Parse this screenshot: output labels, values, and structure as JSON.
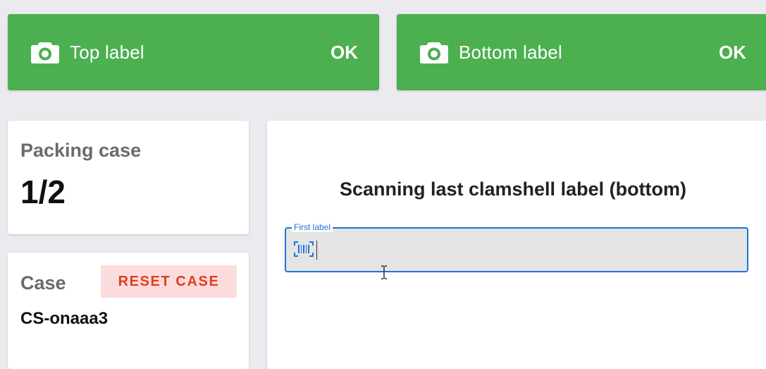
{
  "status_cards": {
    "top": {
      "label": "Top label",
      "status": "OK",
      "icon": "camera-icon"
    },
    "bottom": {
      "label": "Bottom label",
      "status": "OK",
      "icon": "camera-icon"
    }
  },
  "packing_case": {
    "title": "Packing case",
    "value": "1/2"
  },
  "case": {
    "title": "Case",
    "reset_label": "RESET CASE",
    "case_id": "CS-onaaa3"
  },
  "scan": {
    "heading": "Scanning last clamshell label (bottom)",
    "input": {
      "legend": "First label",
      "value": "",
      "icon": "barcode-scan-icon"
    }
  },
  "colors": {
    "success": "#4caf50",
    "accent": "#1f73d9",
    "danger_text": "#e03e1c",
    "danger_bg": "#fbdcdc",
    "background": "#ebebef"
  }
}
